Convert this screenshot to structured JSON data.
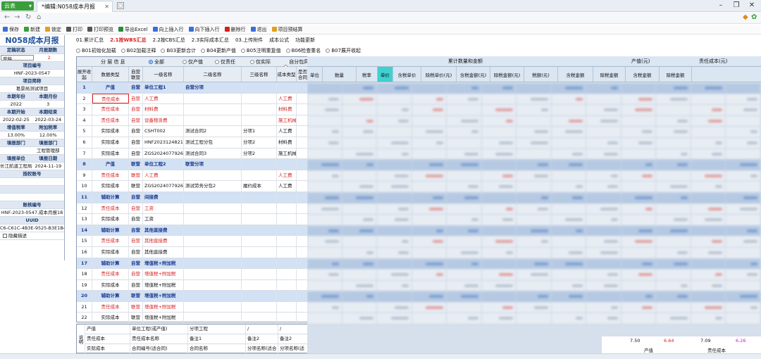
{
  "app": {
    "name": "云表",
    "tab_title": "*编辑:N058成本月报"
  },
  "toolbar": [
    {
      "label": "保存",
      "icon": "save-icon",
      "color": "#3a6fd8"
    },
    {
      "label": "新建",
      "icon": "new-icon",
      "color": "#3a9e3a"
    },
    {
      "label": "锁定",
      "icon": "lock-icon",
      "color": "#e0a020"
    },
    {
      "label": "打印",
      "icon": "print-icon",
      "color": "#555"
    },
    {
      "label": "打印预览",
      "icon": "print-preview-icon",
      "color": "#555"
    },
    {
      "label": "导出Excel",
      "icon": "excel-icon",
      "color": "#2b8a3e"
    },
    {
      "label": "向上插入行",
      "icon": "insert-up-icon",
      "color": "#3a6fd8"
    },
    {
      "label": "向下插入行",
      "icon": "insert-down-icon",
      "color": "#3a6fd8"
    },
    {
      "label": "删除行",
      "icon": "delete-row-icon",
      "color": "#d62020"
    },
    {
      "label": "退出",
      "icon": "exit-icon",
      "color": "#3a6fd8"
    },
    {
      "label": "项目预结算",
      "icon": "project-icon",
      "color": "#e0a020"
    }
  ],
  "left": {
    "title": "N058成本月报",
    "pairs": [
      {
        "h1": "定稿状态",
        "h2": "月报期数",
        "v1": "草稿",
        "v2": "2"
      },
      {
        "full_h": "项目编号",
        "full_v": "HNF-2023-0547"
      },
      {
        "full_h": "项目简称",
        "full_v": "葛景局测试项目"
      },
      {
        "h1": "本期年份",
        "h2": "本期月份",
        "v1": "2022",
        "v2": "3"
      },
      {
        "h1": "本期开始",
        "h2": "本期结束",
        "v1": "2022-02-25",
        "v2": "2022-03-24"
      },
      {
        "h1": "增值税率",
        "h2": "附加税率",
        "v1": "13.00%",
        "v2": "12.00%"
      },
      {
        "h1": "填报部门",
        "h2": "填报部门",
        "v1": "",
        "v2": "工程管理部"
      },
      {
        "h1": "填报单位",
        "h2": "填报日期",
        "v1": "长江航道工程局",
        "v2": "2024-11-19"
      },
      {
        "full_h": "授权账号",
        "full_v": ""
      },
      {
        "full_h": "",
        "full_v": ""
      },
      {
        "full_h": "账核编号",
        "full_v": "HNF-2023-0547.成本月报18"
      },
      {
        "full_h": "UUID",
        "full_v": "C6-C61C-4B3E-9525-B3E1B4"
      }
    ],
    "checkbox": "隐藏描述"
  },
  "options": {
    "row1": [
      "01.累计汇总",
      "2.1按WBS汇总",
      "2.2按CBS汇总",
      "2.3实际成本汇总",
      "03.上传附件",
      "成本公式",
      "功能更新"
    ],
    "row1_active": 1,
    "row2": [
      "B01初始化加载",
      "B02加载注释",
      "B03更新合计",
      "B04更新产值",
      "B05注明重复值",
      "B06检查重名",
      "B07展开收起"
    ]
  },
  "grid": {
    "filter_label": "分 层 信 息",
    "filters": [
      "全部",
      "仅产值",
      "仅责任",
      "仅实际",
      "自分包异常"
    ],
    "headers": [
      "展开收起",
      "数据类型",
      "自营联营",
      "一级名称",
      "二级名称",
      "三级名称",
      "成本类型",
      "是否合同"
    ],
    "rows": [
      {
        "n": "1",
        "type": "产值",
        "mode": "自营",
        "l1": "单位工程1",
        "l2": "自营分项",
        "l3": "",
        "ct": "",
        "k": "blue"
      },
      {
        "n": "2",
        "type": "责任成本",
        "mode": "自营",
        "l1": "人工费",
        "l2": "",
        "l3": "",
        "ct": "人工费",
        "k": "red"
      },
      {
        "n": "3",
        "type": "责任成本",
        "mode": "自营",
        "l1": "材料费",
        "l2": "",
        "l3": "",
        "ct": "材料费",
        "k": "red"
      },
      {
        "n": "4",
        "type": "责任成本",
        "mode": "自营",
        "l1": "设备租赁费",
        "l2": "",
        "l3": "",
        "ct": "施工机械使用费",
        "k": "red"
      },
      {
        "n": "5",
        "type": "实际成本",
        "mode": "自营",
        "l1": "CSHT002",
        "l2": "测试合同2",
        "l3": "分项1",
        "ct": "人工费",
        "k": ""
      },
      {
        "n": "6",
        "type": "实际成本",
        "mode": "自营",
        "l1": "HNF2023124821",
        "l2": "测试工程分包",
        "l3": "分项2",
        "ct": "材料费",
        "k": ""
      },
      {
        "n": "7",
        "type": "实际成本",
        "mode": "自营",
        "l1": "ZGS2024077926",
        "l2": "测试合同3",
        "l3": "分项2",
        "ct": "施工机械使用费",
        "k": ""
      },
      {
        "n": "8",
        "type": "产值",
        "mode": "联营",
        "l1": "单位工程2",
        "l2": "联营分项",
        "l3": "",
        "ct": "",
        "k": "blue"
      },
      {
        "n": "9",
        "type": "责任成本",
        "mode": "联营",
        "l1": "人工费",
        "l2": "",
        "l3": "",
        "ct": "人工费",
        "k": "red"
      },
      {
        "n": "10",
        "type": "实际成本",
        "mode": "联营",
        "l1": "ZGS2024077926",
        "l2": "测试劳务分包2",
        "l3": "履约成本",
        "ct": "人工费",
        "k": ""
      },
      {
        "n": "11",
        "type": "辅助计算",
        "mode": "自营",
        "l1": "间接费",
        "l2": "",
        "l3": "",
        "ct": "",
        "k": "blue"
      },
      {
        "n": "12",
        "type": "责任成本",
        "mode": "自营",
        "l1": "工资",
        "l2": "",
        "l3": "",
        "ct": "",
        "k": "red"
      },
      {
        "n": "13",
        "type": "实际成本",
        "mode": "自营",
        "l1": "工资",
        "l2": "",
        "l3": "",
        "ct": "",
        "k": ""
      },
      {
        "n": "14",
        "type": "辅助计算",
        "mode": "自营",
        "l1": "其他直接费",
        "l2": "",
        "l3": "",
        "ct": "",
        "k": "blue"
      },
      {
        "n": "15",
        "type": "责任成本",
        "mode": "自营",
        "l1": "其他直接费",
        "l2": "",
        "l3": "",
        "ct": "",
        "k": "red"
      },
      {
        "n": "16",
        "type": "实际成本",
        "mode": "自营",
        "l1": "其他直接费",
        "l2": "",
        "l3": "",
        "ct": "",
        "k": ""
      },
      {
        "n": "17",
        "type": "辅助计算",
        "mode": "自营",
        "l1": "增值税+附加税",
        "l2": "",
        "l3": "",
        "ct": "",
        "k": "blue"
      },
      {
        "n": "18",
        "type": "责任成本",
        "mode": "自营",
        "l1": "增值税+附加税",
        "l2": "",
        "l3": "",
        "ct": "",
        "k": "red"
      },
      {
        "n": "19",
        "type": "实际成本",
        "mode": "自营",
        "l1": "增值税+附加税",
        "l2": "",
        "l3": "",
        "ct": "",
        "k": ""
      },
      {
        "n": "20",
        "type": "辅助计算",
        "mode": "联营",
        "l1": "增值税+附加税",
        "l2": "",
        "l3": "",
        "ct": "",
        "k": "blue"
      },
      {
        "n": "21",
        "type": "责任成本",
        "mode": "联营",
        "l1": "增值税+附加税",
        "l2": "",
        "l3": "",
        "ct": "",
        "k": "red"
      },
      {
        "n": "22",
        "type": "实际成本",
        "mode": "联营",
        "l1": "增值税+附加税",
        "l2": "",
        "l3": "",
        "ct": "",
        "k": ""
      }
    ]
  },
  "footer": {
    "label": "说明",
    "rows": [
      [
        "产值",
        "单位工程(或产值)",
        "分项工程",
        "/",
        "/"
      ],
      [
        "责任成本",
        "责任成本名称",
        "备注1",
        "备注2",
        "备注2"
      ],
      [
        "实际成本",
        "合同编号(适合同)",
        "合同名称",
        "分项名称(适合",
        "分项名称(适"
      ]
    ],
    "side": "调整初始化"
  },
  "right": {
    "group1": "累计数量和金额",
    "group2": "产值(元)",
    "group3": "责任成本(元)",
    "headers": [
      "单位",
      "数量",
      "税率",
      "单价",
      "含税单价",
      "除税单价(元)",
      "含税金额(元)",
      "除税金额(元)",
      "税额(元)",
      "含税金额",
      "除税金额",
      "含税金额",
      "除税金额"
    ],
    "sum": {
      "v1": "7.50",
      "v2": "6.64",
      "v3": "7.09",
      "v4": "6.26",
      "l1": "产值",
      "l2": "责任成本"
    }
  }
}
